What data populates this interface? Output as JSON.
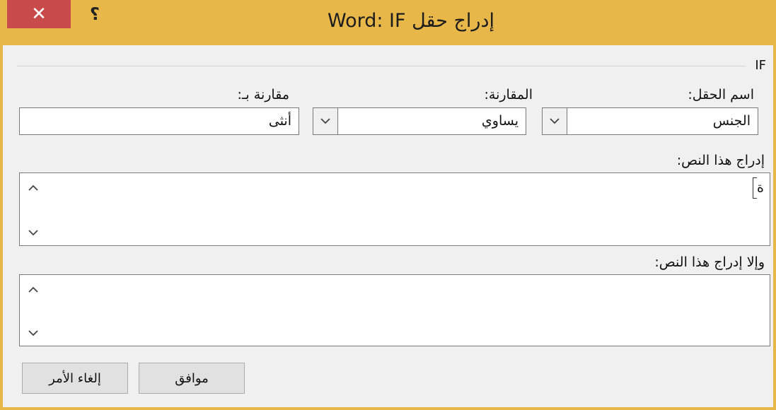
{
  "window": {
    "title": "إدراج حقل Word: IF",
    "close_symbol": "✕",
    "help_symbol": "؟"
  },
  "group": {
    "label": "IF"
  },
  "field_name": {
    "label": "اسم الحقل:",
    "value": "الجنس"
  },
  "comparison": {
    "label": "المقارنة:",
    "value": "يساوي"
  },
  "compare_to": {
    "label": "مقارنة بـ:",
    "value": "أنثى"
  },
  "insert_text": {
    "label": "إدراج هذا النص:",
    "value": "ة"
  },
  "otherwise_text": {
    "label": "وإلا إدراج هذا النص:",
    "value": ""
  },
  "buttons": {
    "ok": "موافق",
    "cancel": "إلغاء الأمر"
  },
  "colors": {
    "titlebar": "#e8b74a",
    "close": "#c94a4a",
    "background": "#f0f0f0"
  }
}
